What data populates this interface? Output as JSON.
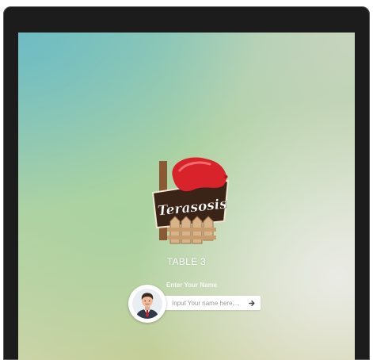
{
  "brand": {
    "name": "Terasosis"
  },
  "table": {
    "label": "TABLE 3"
  },
  "name_form": {
    "label": "Enter Your Name",
    "placeholder": "Input Your name here....",
    "value": ""
  },
  "icons": {
    "submit": "arrow-right-icon",
    "avatar": "user-avatar-icon"
  },
  "colors": {
    "device_frame": "#1c1c1c",
    "sausage": "#d9232b",
    "banner": "#3a2418",
    "fence": "#c8a57a"
  }
}
